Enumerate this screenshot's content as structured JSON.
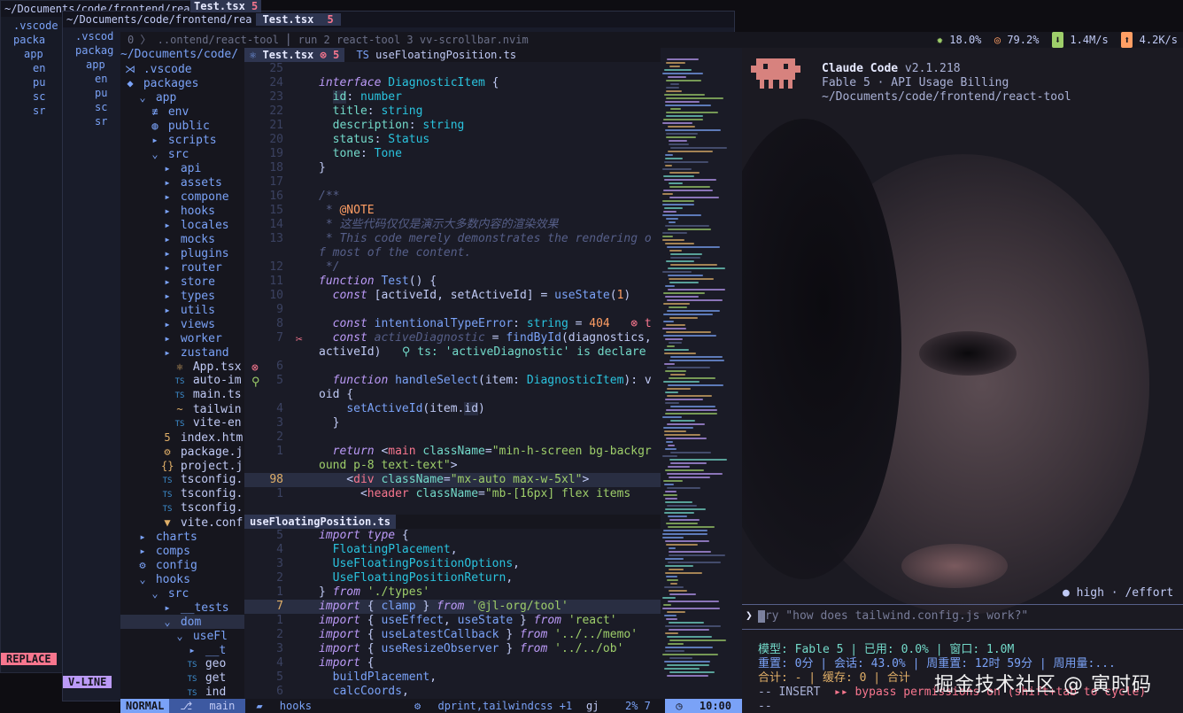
{
  "back_window": {
    "path": "~/Documents/code/frontend/rea",
    "tab": "Test.tsx",
    "tab_errors": "5",
    "items": [
      ".vscode",
      "packa",
      "app",
      "en",
      "pu",
      "sc",
      "sr"
    ],
    "mode": "REPLACE"
  },
  "mid_window": {
    "path": "~/Documents/code/frontend/rea",
    "tab": "Test.tsx",
    "tab_errors": "5",
    "items": [
      ".vscod",
      "packag",
      "app",
      "en",
      "pu",
      "sc",
      "sr"
    ],
    "mode": "V-LINE"
  },
  "topbar": {
    "left": "0 〉 ..ontend/react-tool ⎮ run  2 react-tool  3 vv-scrollbar.nvim",
    "cpu": "18.0%",
    "mem": "79.2%",
    "down": "1.4M/s",
    "up": "4.2K/s"
  },
  "explorer": {
    "root": "~/Documents/code/",
    "items": [
      {
        "d": 0,
        "icon": "⋊",
        "name": ".vscode",
        "dir": true
      },
      {
        "d": 0,
        "icon": "◆",
        "name": "packages",
        "dir": true
      },
      {
        "d": 1,
        "icon": "⌄",
        "name": "app",
        "dir": true
      },
      {
        "d": 2,
        "icon": "≢",
        "name": "env",
        "dir": true
      },
      {
        "d": 2,
        "icon": "◍",
        "name": "public",
        "dir": true
      },
      {
        "d": 2,
        "icon": "▸",
        "name": "scripts",
        "dir": true
      },
      {
        "d": 2,
        "icon": "⌄",
        "name": "src",
        "dir": true
      },
      {
        "d": 3,
        "icon": "▸",
        "name": "api",
        "dir": true
      },
      {
        "d": 3,
        "icon": "▸",
        "name": "assets",
        "dir": true
      },
      {
        "d": 3,
        "icon": "▸",
        "name": "compone",
        "dir": true
      },
      {
        "d": 3,
        "icon": "▸",
        "name": "hooks",
        "dir": true
      },
      {
        "d": 3,
        "icon": "▸",
        "name": "locales",
        "dir": true
      },
      {
        "d": 3,
        "icon": "▸",
        "name": "mocks",
        "dir": true
      },
      {
        "d": 3,
        "icon": "▸",
        "name": "plugins",
        "dir": true
      },
      {
        "d": 3,
        "icon": "▸",
        "name": "router",
        "dir": true
      },
      {
        "d": 3,
        "icon": "▸",
        "name": "store",
        "dir": true
      },
      {
        "d": 3,
        "icon": "▸",
        "name": "types",
        "dir": true
      },
      {
        "d": 3,
        "icon": "▸",
        "name": "utils",
        "dir": true
      },
      {
        "d": 3,
        "icon": "▸",
        "name": "views",
        "dir": true
      },
      {
        "d": 3,
        "icon": "▸",
        "name": "worker",
        "dir": true
      },
      {
        "d": 3,
        "icon": "▸",
        "name": "zustand",
        "dir": true
      },
      {
        "d": 4,
        "icon": "⚛",
        "name": "App.tsx",
        "dir": false
      },
      {
        "d": 4,
        "icon": "TS",
        "name": "auto-im",
        "dir": false
      },
      {
        "d": 4,
        "icon": "TS",
        "name": "main.ts",
        "dir": false
      },
      {
        "d": 4,
        "icon": "~",
        "name": "tailwin",
        "dir": false
      },
      {
        "d": 4,
        "icon": "TS",
        "name": "vite-en",
        "dir": false
      },
      {
        "d": 3,
        "icon": "5",
        "name": "index.htm",
        "dir": false
      },
      {
        "d": 3,
        "icon": "⚙",
        "name": "package.j",
        "dir": false
      },
      {
        "d": 3,
        "icon": "{}",
        "name": "project.j",
        "dir": false
      },
      {
        "d": 3,
        "icon": "TS",
        "name": "tsconfig.",
        "dir": false
      },
      {
        "d": 3,
        "icon": "TS",
        "name": "tsconfig.",
        "dir": false
      },
      {
        "d": 3,
        "icon": "TS",
        "name": "tsconfig.",
        "dir": false
      },
      {
        "d": 3,
        "icon": "▼",
        "name": "vite.conf",
        "dir": false
      },
      {
        "d": 1,
        "icon": "▸",
        "name": "charts",
        "dir": true
      },
      {
        "d": 1,
        "icon": "▸",
        "name": "comps",
        "dir": true
      },
      {
        "d": 1,
        "icon": "⚙",
        "name": "config",
        "dir": true
      },
      {
        "d": 1,
        "icon": "⌄",
        "name": "hooks",
        "dir": true
      },
      {
        "d": 2,
        "icon": "⌄",
        "name": "src",
        "dir": true
      },
      {
        "d": 3,
        "icon": "▸",
        "name": "__tests",
        "dir": true
      },
      {
        "d": 3,
        "icon": "⌄",
        "name": "dom",
        "dir": true
      },
      {
        "d": 4,
        "icon": "⌄",
        "name": "useFl",
        "dir": true
      },
      {
        "d": 5,
        "icon": "▸",
        "name": "__t",
        "dir": true
      },
      {
        "d": 5,
        "icon": "TS",
        "name": "geo",
        "dir": false
      },
      {
        "d": 5,
        "icon": "TS",
        "name": "get",
        "dir": false
      },
      {
        "d": 5,
        "icon": "TS",
        "name": "ind",
        "dir": false
      }
    ]
  },
  "pane1": {
    "tabs": [
      "Test.tsx",
      "useFloatingPosition.ts"
    ],
    "tab_errors": "5",
    "lines": [
      {
        "n": "25",
        "html": ""
      },
      {
        "n": "24",
        "html": "<span class='kw'>interface</span> <span class='ty'>DiagnosticItem</span> {"
      },
      {
        "n": "23",
        "html": "  <span class='pr hl'>id</span>: <span class='ty'>number</span>"
      },
      {
        "n": "22",
        "html": "  <span class='pr'>title</span>: <span class='ty'>string</span>"
      },
      {
        "n": "21",
        "html": "  <span class='pr'>description</span>: <span class='ty'>string</span>"
      },
      {
        "n": "20",
        "html": "  <span class='pr'>status</span>: <span class='ty'>Status</span>"
      },
      {
        "n": "19",
        "html": "  <span class='pr'>tone</span>: <span class='ty'>Tone</span>"
      },
      {
        "n": "18",
        "html": "}"
      },
      {
        "n": "17",
        "html": ""
      },
      {
        "n": "16",
        "html": "<span class='cm'>/**</span>"
      },
      {
        "n": "15",
        "html": "<span class='cm'> * </span><span class='num'>@NOTE</span>"
      },
      {
        "n": "14",
        "html": "<span class='cm'> * 这些代码仅仅是演示大多数内容的渲染效果</span>"
      },
      {
        "n": "13",
        "html": "<span class='cm'> * This code merely demonstrates the rendering o</span>"
      },
      {
        "n": "",
        "html": "<span class='cm'>f most of the content.</span>"
      },
      {
        "n": "12",
        "html": "<span class='cm'> */</span>"
      },
      {
        "n": "11",
        "html": "<span class='kw'>function</span> <span class='fn'>Test</span>() {"
      },
      {
        "n": "10",
        "html": "  <span class='kw'>const</span> [activeId, setActiveId] = <span class='fn'>useState</span>(<span class='num'>1</span>)"
      },
      {
        "n": "9",
        "html": ""
      },
      {
        "n": "8",
        "html": "  <span class='kw'>const</span> <span class='fn'>intentionalTypeError</span>: <span class='ty'>string</span> = <span class='num'>404</span>   <span class='err'>⊗ t</span>"
      },
      {
        "n": "7",
        "html": "  <span class='kw'>const</span> <span class='cm'>activeDiagnostic</span> = <span class='fn'>findById</span>(diagnostics,"
      },
      {
        "n": "",
        "html": "activeId)   <span class='pr'>⚲ ts: 'activeDiagnostic' is declare</span>"
      },
      {
        "n": "6",
        "html": ""
      },
      {
        "n": "5",
        "html": "  <span class='kw'>function</span> <span class='fn'>handleSelect</span>(item: <span class='ty'>DiagnosticItem</span>): v"
      },
      {
        "n": "",
        "html": "oid {"
      },
      {
        "n": "4",
        "html": "    <span class='fn'>setActiveId</span>(item.<span class='hl'>id</span>)"
      },
      {
        "n": "3",
        "html": "  }"
      },
      {
        "n": "2",
        "html": ""
      },
      {
        "n": "1",
        "html": "  <span class='kw'>return</span> &lt;<span class='tag'>main</span> <span class='pr'>className</span>=<span class='str'>\"min-h-screen bg-backgr</span>"
      },
      {
        "n": "",
        "html": "<span class='str'>ound p-8 text-text\"</span>&gt;"
      },
      {
        "n": "98",
        "html": "    &lt;<span class='tag'>div</span> <span class='pr'>className</span>=<span class='str'>\"mx-auto max-w-5xl\"</span>&gt;"
      },
      {
        "n": "1",
        "html": "      &lt;<span class='tag'>header</span> <span class='pr'>className</span>=<span class='str'>\"mb-[16px] flex items</span>"
      }
    ]
  },
  "pane2": {
    "tab": "useFloatingPosition.ts",
    "lines": [
      {
        "n": "5",
        "html": "<span class='kw'>import</span> <span class='kw'>type</span> {"
      },
      {
        "n": "4",
        "html": "  <span class='ty'>FloatingPlacement</span>,"
      },
      {
        "n": "3",
        "html": "  <span class='ty'>UseFloatingPositionOptions</span>,"
      },
      {
        "n": "2",
        "html": "  <span class='ty'>UseFloatingPositionReturn</span>,"
      },
      {
        "n": "1",
        "html": "} <span class='kw'>from</span> <span class='str'>'./types'</span>"
      },
      {
        "n": "7",
        "html": "<span class='kw'>import</span> { <span class='fn'>clamp</span> } <span class='kw'>from</span> <span class='str'>'@jl-org/tool'</span>"
      },
      {
        "n": "1",
        "html": "<span class='kw'>import</span> { <span class='fn'>useEffect</span>, <span class='fn'>useState</span> } <span class='kw'>from</span> <span class='str'>'react'</span>"
      },
      {
        "n": "2",
        "html": "<span class='kw'>import</span> { <span class='fn'>useLatestCallback</span> } <span class='kw'>from</span> <span class='str'>'../../memo'</span>"
      },
      {
        "n": "3",
        "html": "<span class='kw'>import</span> { <span class='fn'>useResizeObserver</span> } <span class='kw'>from</span> <span class='str'>'../../ob'</span>"
      },
      {
        "n": "4",
        "html": "<span class='kw'>import</span> {"
      },
      {
        "n": "5",
        "html": "  <span class='fn'>buildPlacement</span>,"
      },
      {
        "n": "6",
        "html": "  <span class='fn'>calcCoords</span>,"
      }
    ]
  },
  "terminal": {
    "title": "Claude Code",
    "version": "v2.1.218",
    "subtitle": "Fable 5 · API Usage Billing",
    "path": "~/Documents/code/frontend/react-tool",
    "effort": "● high · /effort",
    "prompt_symbol": "❯",
    "placeholder": "Try \"how does tailwind.config.js work?\"",
    "stats1": "模型: Fable 5 | 已用: 0.0% | 窗口: 1.0M",
    "stats2": "重置: 0分 | 会话: 43.0% | 周重置: 12时 59分 | 周用量:...",
    "stats3": "合计: - | 缓存: 0 | 合计",
    "insert": "-- INSERT",
    "bypass": "▸▸ bypass permissions on (shift+tab to cycle)",
    "dashes": "--"
  },
  "status": {
    "mode": "NORMAL",
    "branch": "main",
    "dir": "hooks",
    "lsp": "dprint,tailwindcss +1",
    "keys": "gj",
    "percent": "2% 7",
    "time": "10:00"
  },
  "watermark": "掘金技术社区 @ 寅时码"
}
